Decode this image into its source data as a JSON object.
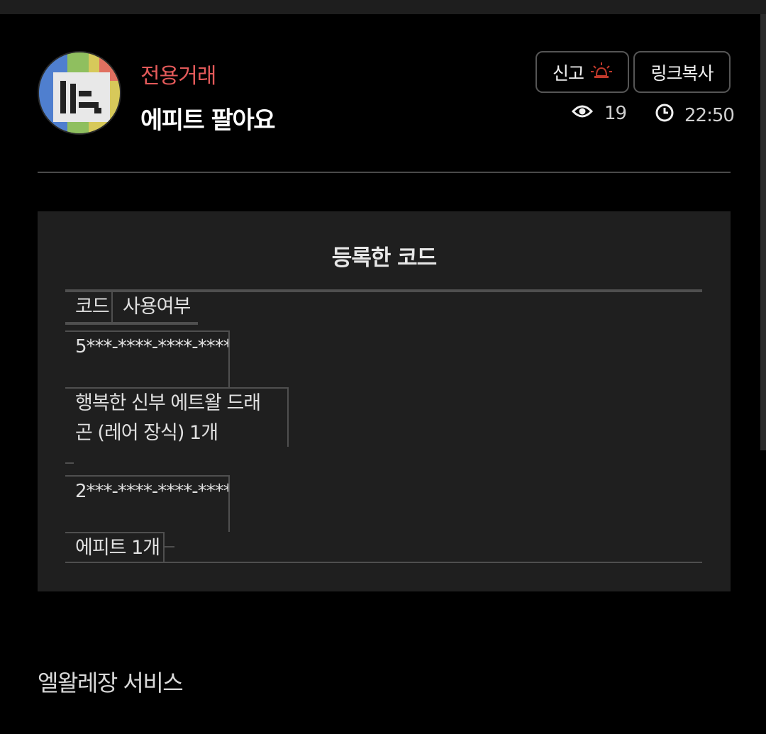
{
  "post": {
    "category": "전용거래",
    "title": "에피트 팔아요",
    "report_label": "신고",
    "copy_link_label": "링크복사",
    "views": "19",
    "time": "22:50"
  },
  "codes": {
    "title": "등록한 코드",
    "headers": {
      "code": "코드",
      "used": "사용여부"
    },
    "rows": [
      {
        "code": "5***-****-****-****",
        "item": "행복한 신부 에트왈 드래곤 (레어 장식) 1개",
        "used": "–"
      },
      {
        "code": "2***-****-****-****",
        "item": "에피트 1개",
        "used": "–"
      }
    ]
  },
  "footer": {
    "label": "엘왈레장 서비스"
  },
  "colors": {
    "accent": "#e45a5a",
    "background": "#000000",
    "panel": "#1f1f1f"
  },
  "icons": {
    "report": "siren-icon",
    "views": "eye-icon",
    "time": "clock-icon"
  }
}
